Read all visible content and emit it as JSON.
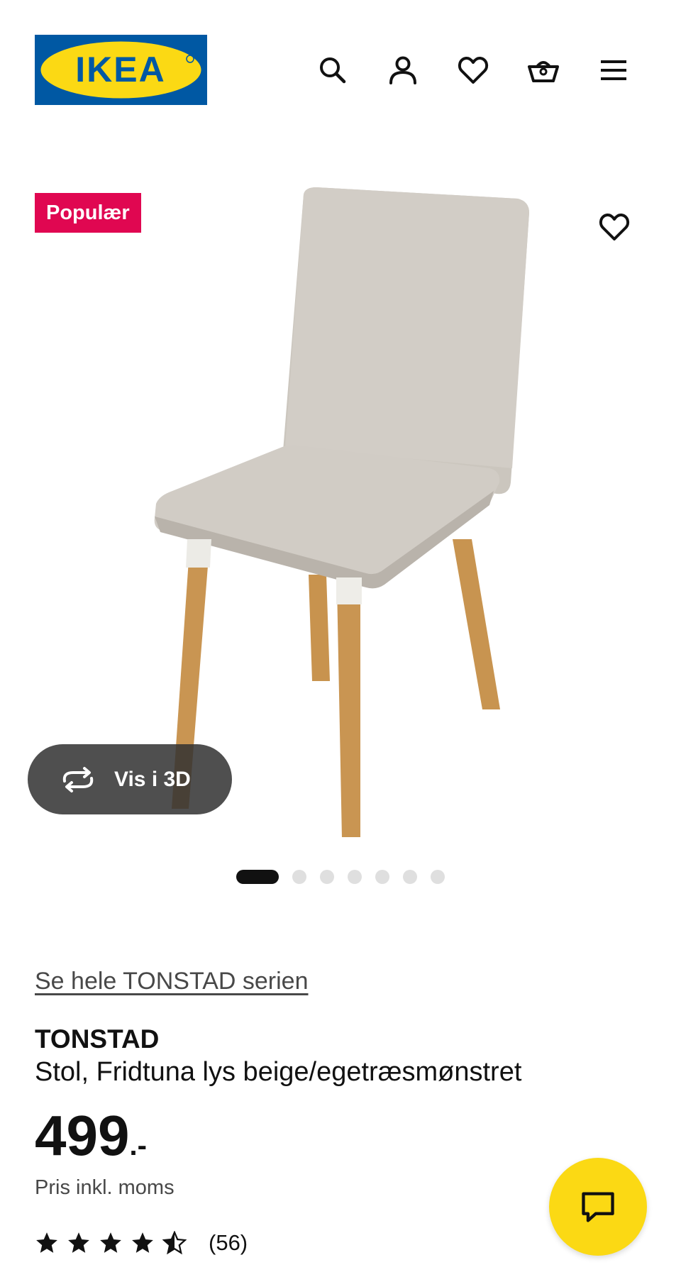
{
  "header": {
    "logo_text": "IKEA",
    "icons": [
      "search-icon",
      "account-icon",
      "heart-icon",
      "basket-icon",
      "menu-icon"
    ]
  },
  "media": {
    "badge": "Populær",
    "view_3d_label": "Vis i 3D",
    "image_count": 7,
    "active_image": 1
  },
  "product": {
    "series_link": "Se hele TONSTAD serien",
    "name": "TONSTAD",
    "description": "Stol, Fridtuna lys beige/egetræsmønstret",
    "price": "499",
    "price_suffix": ".-",
    "price_note": "Pris inkl. moms",
    "rating_stars": 4.5,
    "rating_count": "(56)"
  },
  "colors": {
    "ikea_blue": "#0058a3",
    "ikea_yellow": "#fbd914",
    "badge_red": "#e00751",
    "text_dark": "#111111",
    "text_muted": "#484848"
  }
}
